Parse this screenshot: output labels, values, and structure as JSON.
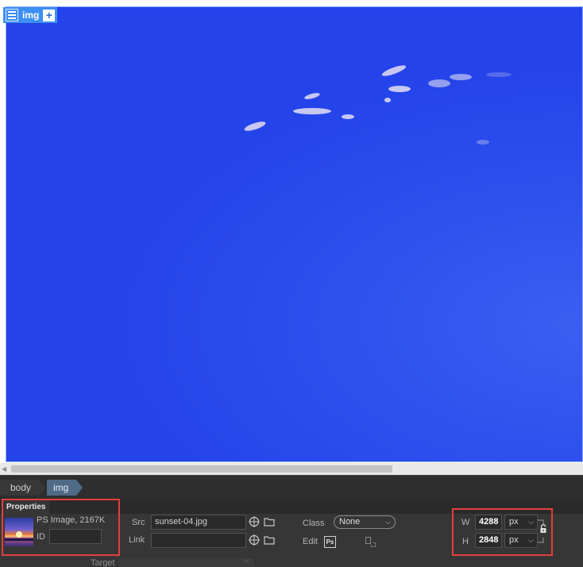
{
  "design_view": {
    "element_tag": {
      "label": "img"
    }
  },
  "tag_selector": {
    "items": [
      {
        "label": "body"
      },
      {
        "label": "img"
      }
    ]
  },
  "properties": {
    "tab_label": "Properties",
    "image_info": "PS Image, 2167K",
    "id_label": "ID",
    "id_value": "",
    "src_label": "Src",
    "src_value": "sunset-04.jpg",
    "link_label": "Link",
    "link_value": "",
    "class_label": "Class",
    "class_value": "None",
    "edit_label": "Edit",
    "edit_ps_badge": "Ps",
    "width_label": "W",
    "width_value": "4288",
    "width_unit": "px",
    "height_label": "H",
    "height_value": "2848",
    "height_unit": "px",
    "target_label": "Target"
  },
  "colors": {
    "highlight": "#e2403a",
    "sky": "#2443ea",
    "tag_active": "#4f6b87"
  }
}
